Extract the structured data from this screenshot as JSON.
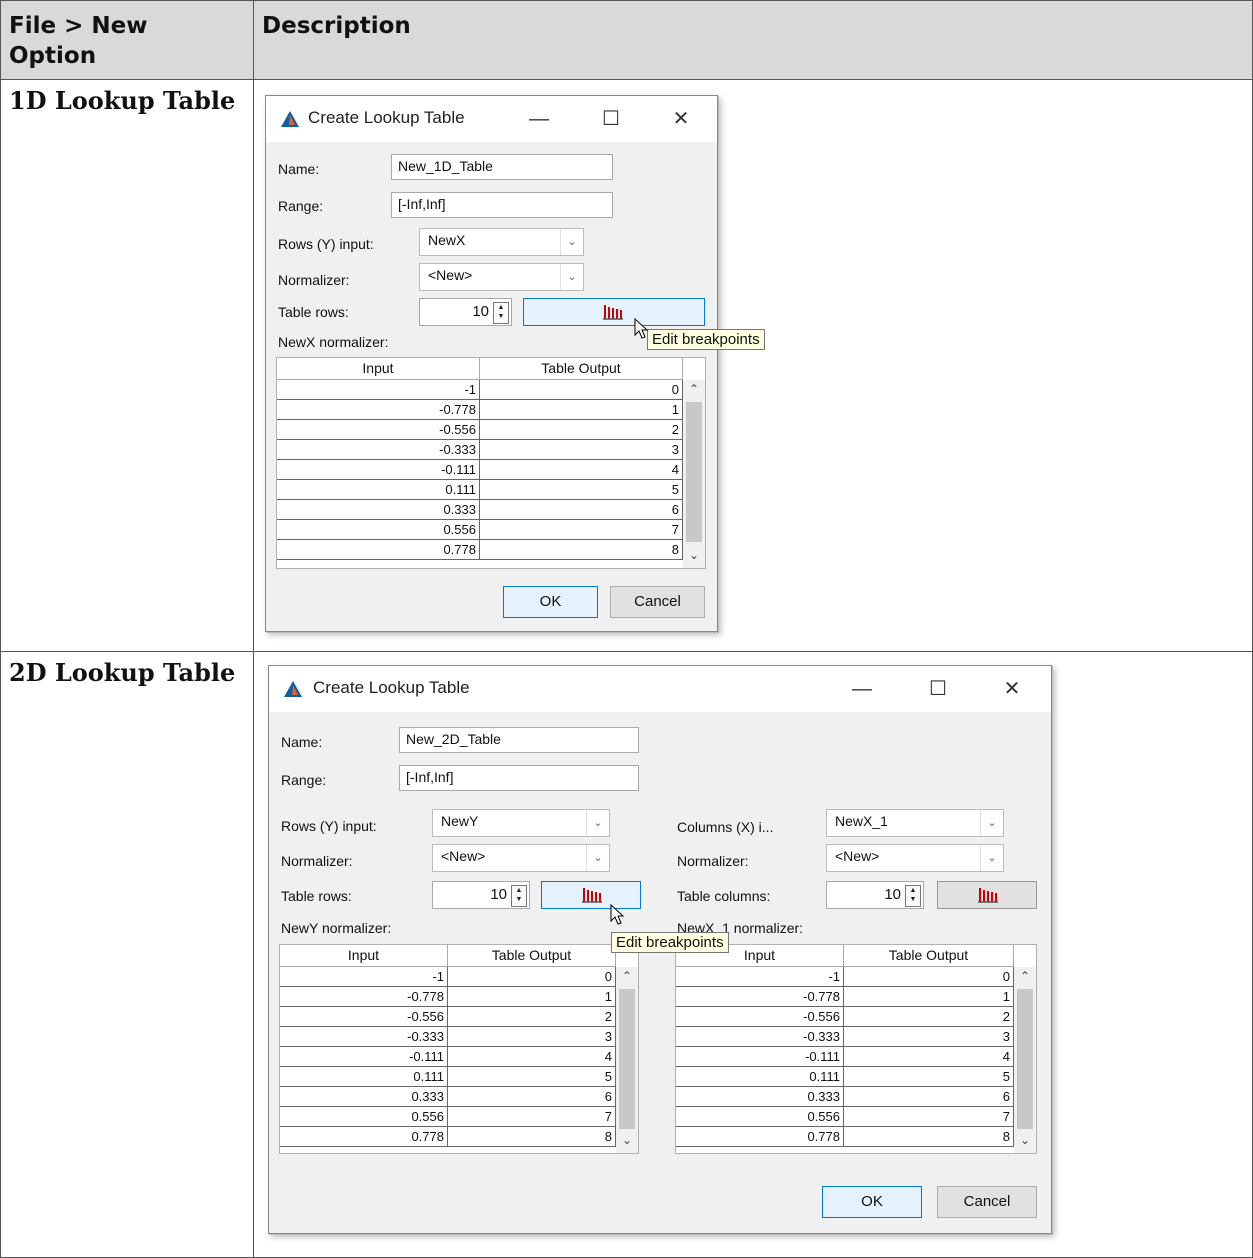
{
  "table": {
    "col1_header": "File > New Option",
    "col2_header": "Description",
    "rows": [
      {
        "option": "1D Lookup Table"
      },
      {
        "option": "2D Lookup Table"
      }
    ]
  },
  "dialog_common": {
    "title": "Create Lookup Table",
    "minimize": "—",
    "maximize": "☐",
    "close": "✕",
    "name_label": "Name:",
    "range_label": "Range:",
    "range_value": "[-Inf,Inf]",
    "normalizer_label": "Normalizer:",
    "normalizer_value": "<New>",
    "table_rows_label": "Table rows:",
    "table_rows_value": "10",
    "tooltip": "Edit breakpoints",
    "input_header": "Input",
    "output_header": "Table Output",
    "ok": "OK",
    "cancel": "Cancel",
    "inputs": [
      "-1",
      "-0.778",
      "-0.556",
      "-0.333",
      "-0.111",
      "0.111",
      "0.333",
      "0.556",
      "0.778"
    ],
    "outputs": [
      "0",
      "1",
      "2",
      "3",
      "4",
      "5",
      "6",
      "7",
      "8"
    ]
  },
  "dialog_1d": {
    "name_value": "New_1D_Table",
    "rows_input_label": "Rows (Y) input:",
    "rows_input_value": "NewX",
    "normalizer_caption": "NewX normalizer:"
  },
  "dialog_2d": {
    "name_value": "New_2D_Table",
    "rows_input_label": "Rows (Y) input:",
    "rows_input_value": "NewY",
    "normalizer_caption": "NewY normalizer:",
    "cols_input_label": "Columns (X) i...",
    "cols_input_value": "NewX_1",
    "table_cols_label": "Table columns:",
    "table_cols_value": "10",
    "cols_normalizer_caption": "NewX_1 normalizer:"
  },
  "colors": {
    "accent": "#0078d7",
    "icon_red": "#cc0000",
    "tooltip_bg": "#ffffe1",
    "header_bg": "#d9d9d9"
  }
}
